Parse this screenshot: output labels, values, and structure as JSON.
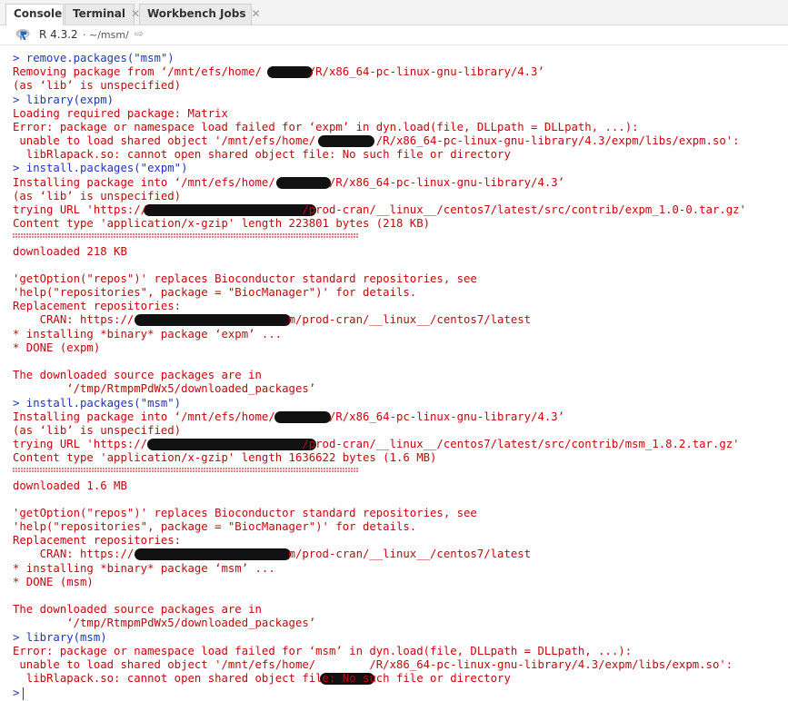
{
  "tabs": [
    {
      "label": "Console",
      "closable": false,
      "active": true
    },
    {
      "label": "Terminal",
      "closable": true,
      "active": false
    },
    {
      "label": "Workbench Jobs",
      "closable": true,
      "active": false
    }
  ],
  "header": {
    "r_version": "R 4.3.2",
    "path": "~/msm/",
    "icons": {
      "logo": "r-logo-icon",
      "nav": "go-to-directory-icon",
      "close": "close-icon"
    }
  },
  "colors": {
    "error_text": "#c5060b",
    "input_text": "#1f34bc",
    "r_logo": "#2267bc"
  },
  "console": {
    "lines": [
      "> remove.packages(\"msm\")",
      "Removing package from ‘/mnt/efs/home/       /R/x86_64-pc-linux-gnu-library/4.3’",
      "(as ‘lib’ is unspecified)",
      "> library(expm)",
      "Loading required package: Matrix",
      "Error: package or namespace load failed for ‘expm’ in dyn.load(file, DLLpath = DLLpath, ...):",
      " unable to load shared object '/mnt/efs/home/         /R/x86_64-pc-linux-gnu-library/4.3/expm/libs/expm.so':",
      "  libRlapack.so: cannot open shared object file: No such file or directory",
      "> install.packages(\"expm\")",
      "Installing package into ‘/mnt/efs/home/        /R/x86_64-pc-linux-gnu-library/4.3’",
      "(as ‘lib’ is unspecified)",
      "trying URL 'https://                       /prod-cran/__linux__/centos7/latest/src/contrib/expm_1.0-0.tar.gz'",
      "Content type 'application/x-gzip' length 223801 bytes (218 KB)",
      "==================================================",
      "downloaded 218 KB",
      "",
      "'getOption(\"repos\")' replaces Bioconductor standard repositories, see",
      "'help(\"repositories\", package = \"BiocManager\")' for details.",
      "Replacement repositories:",
      "    CRAN: https://                       m/prod-cran/__linux__/centos7/latest",
      "* installing *binary* package ‘expm’ ...",
      "* DONE (expm)",
      "",
      "The downloaded source packages are in",
      "        ‘/tmp/RtmpmPdWx5/downloaded_packages’",
      "> install.packages(\"msm\")",
      "Installing package into ‘/mnt/efs/home/        /R/x86_64-pc-linux-gnu-library/4.3’",
      "(as ‘lib’ is unspecified)",
      "trying URL 'https://                       /prod-cran/__linux__/centos7/latest/src/contrib/msm_1.8.2.tar.gz'",
      "Content type 'application/x-gzip' length 1636622 bytes (1.6 MB)",
      "==================================================",
      "downloaded 1.6 MB",
      "",
      "'getOption(\"repos\")' replaces Bioconductor standard repositories, see",
      "'help(\"repositories\", package = \"BiocManager\")' for details.",
      "Replacement repositories:",
      "    CRAN: https://                       m/prod-cran/__linux__/centos7/latest",
      "* installing *binary* package ‘msm’ ...",
      "* DONE (msm)",
      "",
      "The downloaded source packages are in",
      "        ‘/tmp/RtmpmPdWx5/downloaded_packages’",
      "> library(msm)",
      "Error: package or namespace load failed for ‘msm’ in dyn.load(file, DLLpath = DLLpath, ...):",
      " unable to load shared object '/mnt/efs/home/        /R/x86_64-pc-linux-gnu-library/4.3/expm/libs/expm.so':",
      "  libRlapack.so: cannot open shared object file: No such file or directory"
    ],
    "prompt": ">"
  }
}
